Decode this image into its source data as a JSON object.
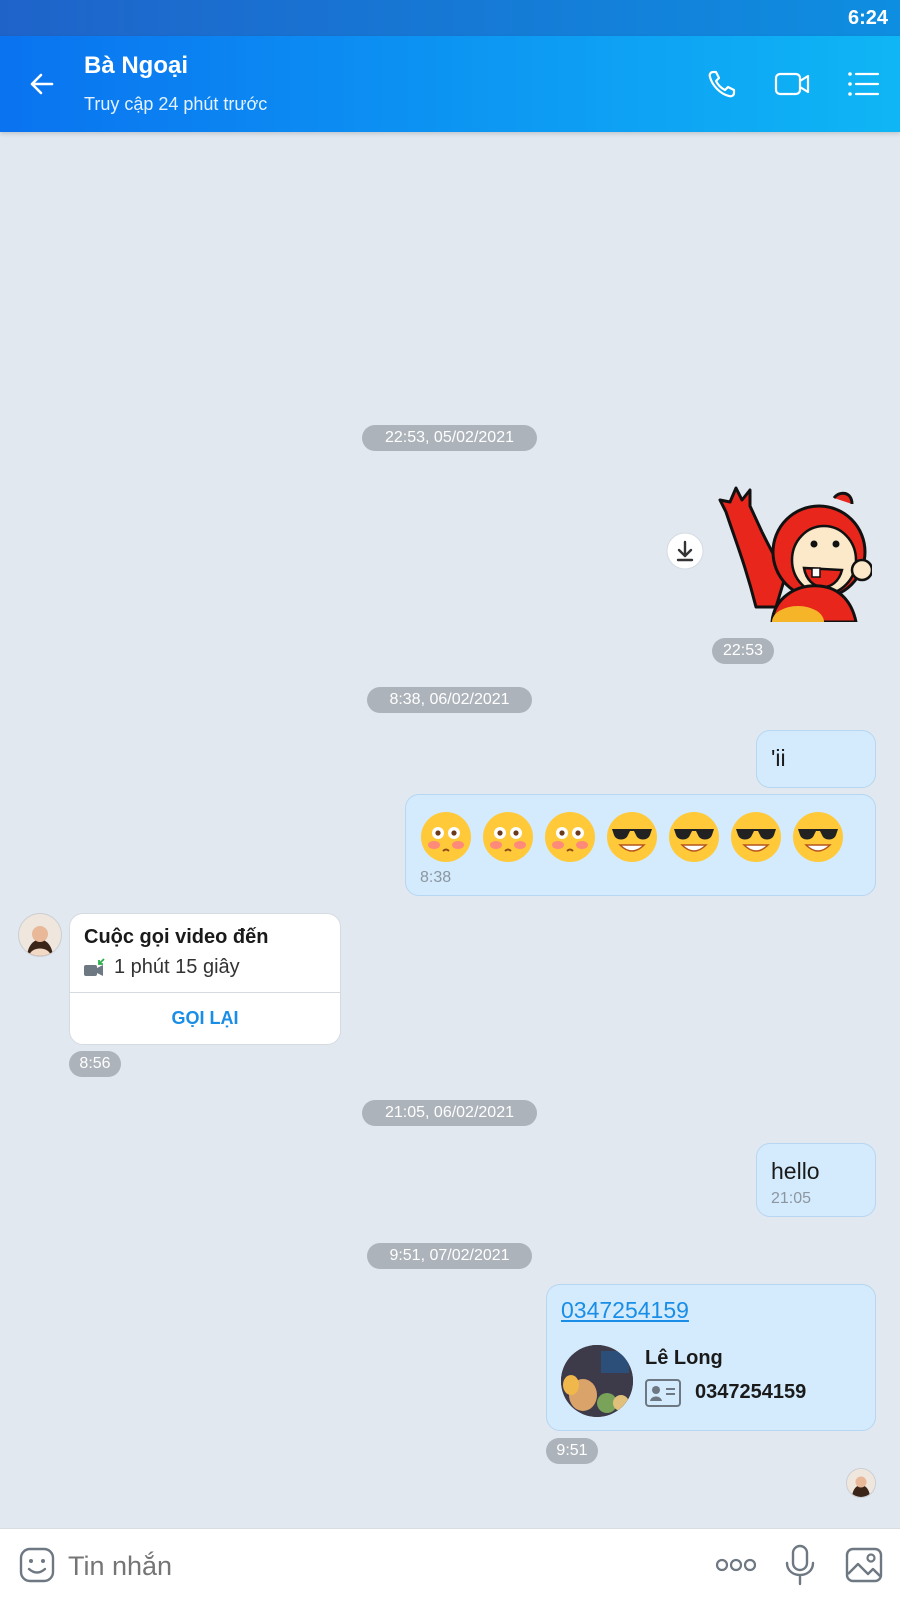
{
  "status_bar": {
    "time": "6:24"
  },
  "header": {
    "contact_name": "Bà Ngoại",
    "last_seen": "Truy cập 24 phút trước",
    "icons": [
      "back-arrow-icon",
      "phone-icon",
      "video-camera-icon",
      "menu-list-icon"
    ]
  },
  "chat": {
    "date_separators": [
      "22:53, 05/02/2021",
      "8:38, 06/02/2021",
      "21:05, 06/02/2021",
      "9:51, 07/02/2021"
    ],
    "sticker_message": {
      "time": "22:53",
      "icon": "download-icon"
    },
    "text_message_1": {
      "text": "'ii"
    },
    "emoji_message": {
      "emojis": [
        "flushed-emoji",
        "flushed-emoji",
        "flushed-emoji",
        "sunglasses-emoji",
        "sunglasses-emoji",
        "sunglasses-emoji",
        "sunglasses-emoji"
      ],
      "time": "8:38"
    },
    "video_call": {
      "title": "Cuộc gọi video đến",
      "duration": "1 phút 15 giây",
      "action": "GỌI LẠI",
      "time": "8:56"
    },
    "text_message_2": {
      "text": "hello",
      "time": "21:05"
    },
    "contact_card": {
      "phone_link": "0347254159",
      "name": "Lê Long",
      "phone": "0347254159",
      "time": "9:51"
    }
  },
  "composer": {
    "placeholder": "Tin nhắn",
    "icons": [
      "sticker-icon",
      "more-icon",
      "microphone-icon",
      "image-icon"
    ]
  },
  "colors": {
    "header_start": "#0a73f0",
    "header_end": "#0fb6f5",
    "chat_background": "#e2e8f0",
    "outgoing_bubble": "#d3ebfc",
    "link": "#1a8ee6"
  }
}
